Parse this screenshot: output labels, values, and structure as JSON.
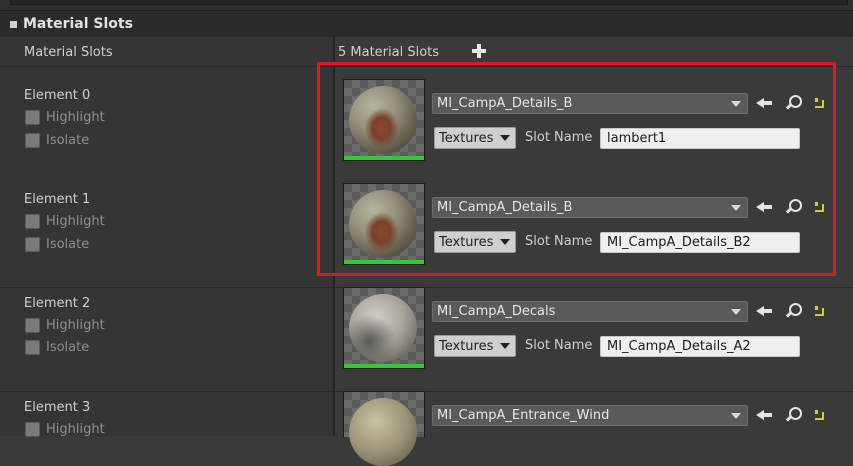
{
  "header": {
    "title": "Material Slots"
  },
  "material_slots": {
    "label": "Material Slots",
    "count_label": "5 Material Slots"
  },
  "elements": [
    {
      "label": "Element 0",
      "highlight_label": "Highlight",
      "isolate_label": "Isolate",
      "material": "MI_CampA_Details_B",
      "textures_label": "Textures",
      "slot_name_label": "Slot Name",
      "slot_name_value": "lambert1"
    },
    {
      "label": "Element 1",
      "highlight_label": "Highlight",
      "isolate_label": "Isolate",
      "material": "MI_CampA_Details_B",
      "textures_label": "Textures",
      "slot_name_label": "Slot Name",
      "slot_name_value": "MI_CampA_Details_B2"
    },
    {
      "label": "Element 2",
      "highlight_label": "Highlight",
      "isolate_label": "Isolate",
      "material": "MI_CampA_Decals",
      "textures_label": "Textures",
      "slot_name_label": "Slot Name",
      "slot_name_value": "MI_CampA_Details_A2"
    },
    {
      "label": "Element 3",
      "highlight_label": "Highlight",
      "material": "MI_CampA_Entrance_Wind"
    }
  ],
  "colors": {
    "annotation_box": "#e01818",
    "thumbnail_bar": "#3cc43c",
    "reset_arrow": "#d4cc2a"
  },
  "icons": [
    "collapse-arrow-icon",
    "add-icon",
    "use-selected-icon",
    "browse-icon",
    "reset-to-default-icon",
    "dropdown-arrow-icon"
  ]
}
